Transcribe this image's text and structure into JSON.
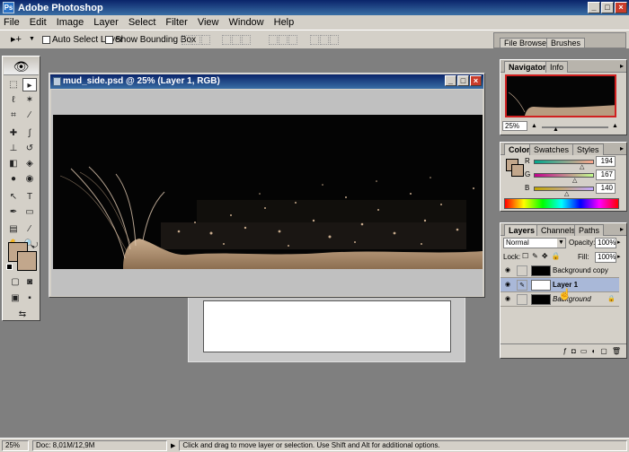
{
  "window": {
    "title": "Adobe Photoshop",
    "buttons": [
      "_",
      "□",
      "×"
    ]
  },
  "menu": [
    "File",
    "Edit",
    "Image",
    "Layer",
    "Select",
    "Filter",
    "View",
    "Window",
    "Help"
  ],
  "options": {
    "tool_glyph": "▸+",
    "auto_select_layer": "Auto Select Layer",
    "show_bounding_box": "Show Bounding Box"
  },
  "palette_well": {
    "tabs": [
      "File Browser",
      "Brushes"
    ]
  },
  "document": {
    "title": "mud_side.psd @ 25% (Layer 1, RGB)"
  },
  "navigator": {
    "tabs": [
      "Navigator",
      "Info"
    ],
    "zoom": "25%"
  },
  "color": {
    "tabs": [
      "Color",
      "Swatches",
      "Styles"
    ],
    "channels": [
      {
        "label": "R",
        "value": "194",
        "fraction": 0.76
      },
      {
        "label": "G",
        "value": "167",
        "fraction": 0.65
      },
      {
        "label": "B",
        "value": "140",
        "fraction": 0.55
      }
    ],
    "foreground": "#c2a78c"
  },
  "layers": {
    "tabs": [
      "Layers",
      "Channels",
      "Paths"
    ],
    "blend_mode": "Normal",
    "opacity_label": "Opacity:",
    "opacity": "100%",
    "lock_label": "Lock:",
    "fill_label": "Fill:",
    "fill": "100%",
    "rows": [
      {
        "name": "Background copy",
        "selected": false
      },
      {
        "name": "Layer 1",
        "selected": true
      },
      {
        "name": "Background",
        "selected": false
      }
    ]
  },
  "status": {
    "zoom": "25%",
    "doc": "Doc: 8,01M/12,9M",
    "hint": "Click and drag to move layer or selection. Use Shift and Alt for additional options."
  }
}
